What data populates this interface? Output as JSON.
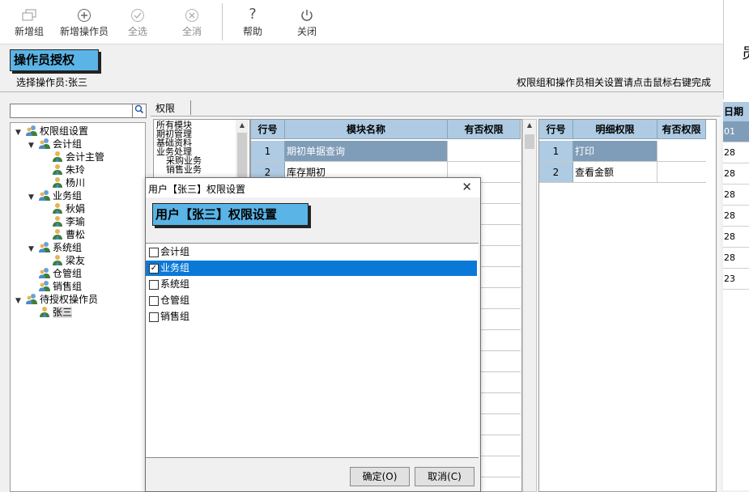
{
  "toolbar": {
    "new_group": "新增组",
    "new_operator": "新增操作员",
    "select_all": "全选",
    "deselect_all": "全消",
    "help": "帮助",
    "close": "关闭"
  },
  "header": {
    "title": "操作员授权",
    "selected_operator": "选择操作员:张三",
    "hint": "权限组和操作员相关设置请点击鼠标右键完成",
    "right_edge_char": "员"
  },
  "tree": {
    "root": "权限组设置",
    "groups": [
      {
        "label": "会计组",
        "members": [
          "会计主管",
          "朱玲",
          "杨川"
        ]
      },
      {
        "label": "业务组",
        "members": [
          "秋娟",
          "李瑜",
          "曹松"
        ]
      },
      {
        "label": "系统组",
        "members": [
          "梁友"
        ]
      },
      {
        "label": "仓管组",
        "members": []
      },
      {
        "label": "销售组",
        "members": []
      }
    ],
    "pending_root": "待授权操作员",
    "pending": [
      "张三"
    ]
  },
  "tabs": {
    "permissions": "权限"
  },
  "modules": [
    "所有模块",
    "期初管理",
    "基础资料",
    "业务处理",
    "采购业务",
    "销售业务"
  ],
  "module_grid": {
    "headers": [
      "行号",
      "模块名称",
      "有否权限"
    ],
    "rows": [
      {
        "no": "1",
        "name": "期初单据查询",
        "has": ""
      },
      {
        "no": "2",
        "name": "库存期初",
        "has": ""
      }
    ]
  },
  "detail_grid": {
    "headers": [
      "行号",
      "明细权限",
      "有否权限"
    ],
    "rows": [
      {
        "no": "1",
        "name": "打印",
        "has": ""
      },
      {
        "no": "2",
        "name": "查看金额",
        "has": ""
      }
    ]
  },
  "date_column": {
    "header": "日期",
    "values": [
      "01",
      "28",
      "28",
      "28",
      "28",
      "28",
      "28",
      "23"
    ]
  },
  "dialog": {
    "title": "用户【张三】权限设置",
    "badge": "用户【张三】权限设置",
    "close_glyph": "✕",
    "items": [
      {
        "label": "会计组",
        "checked": false,
        "selected": false
      },
      {
        "label": "业务组",
        "checked": true,
        "selected": true
      },
      {
        "label": "系统组",
        "checked": false,
        "selected": false
      },
      {
        "label": "仓管组",
        "checked": false,
        "selected": false
      },
      {
        "label": "销售组",
        "checked": false,
        "selected": false
      }
    ],
    "ok": "确定(O)",
    "cancel": "取消(C)"
  },
  "colors": {
    "accent": "#5ab4e6",
    "grid_header": "#aecbe3",
    "selection": "#0a78d7"
  }
}
